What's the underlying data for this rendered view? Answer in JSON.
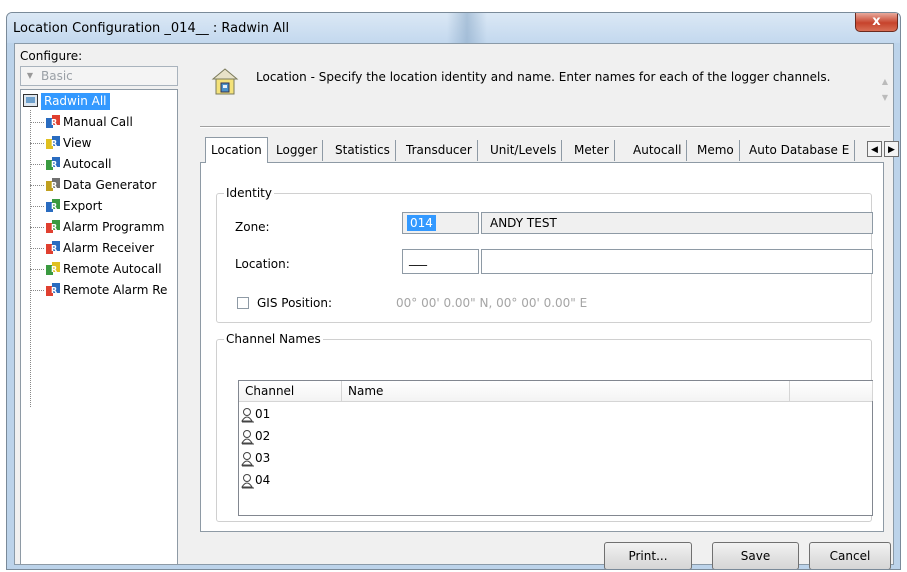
{
  "window": {
    "title": "Location Configuration _014__ : Radwin All",
    "close_label": "x"
  },
  "left": {
    "configure_label": "Configure:",
    "combo_value": "Basic",
    "tree_root": "Radwin All",
    "tree_items": [
      {
        "label": "Manual Call",
        "icon": "manual-call-icon"
      },
      {
        "label": "View",
        "icon": "view-icon"
      },
      {
        "label": "Autocall",
        "icon": "autocall-icon"
      },
      {
        "label": "Data Generator",
        "icon": "data-generator-icon"
      },
      {
        "label": "Export",
        "icon": "export-icon"
      },
      {
        "label": "Alarm Programm",
        "icon": "alarm-programming-icon"
      },
      {
        "label": "Alarm Receiver",
        "icon": "alarm-receiver-icon"
      },
      {
        "label": "Remote Autocall",
        "icon": "remote-autocall-icon"
      },
      {
        "label": "Remote Alarm Re",
        "icon": "remote-alarm-icon"
      }
    ]
  },
  "info": {
    "message": "Location - Specify the location identity and name. Enter names for each of the logger channels."
  },
  "tabs": [
    "Location",
    "Logger",
    "Statistics",
    "Transducer",
    "Unit/Levels",
    "Meter",
    "Autocall",
    "Memo",
    "Auto Database E"
  ],
  "active_tab": "Location",
  "identity": {
    "legend": "Identity",
    "zone_label": "Zone:",
    "zone_code": "014",
    "zone_name": "ANDY TEST",
    "location_label": "Location:",
    "location_code": "___",
    "location_name": "",
    "gis_label": "GIS Position:",
    "gis_value": "00° 00' 0.00\" N, 00° 00' 0.00\" E"
  },
  "channels": {
    "legend": "Channel Names",
    "col_channel": "Channel",
    "col_name": "Name",
    "rows": [
      "01",
      "02",
      "03",
      "04"
    ]
  },
  "buttons": {
    "print": "Print...",
    "save": "Save",
    "cancel": "Cancel"
  },
  "colors": {
    "selection": "#3399ff",
    "titlebar": "#c3d8ee",
    "close": "#c7432c"
  }
}
